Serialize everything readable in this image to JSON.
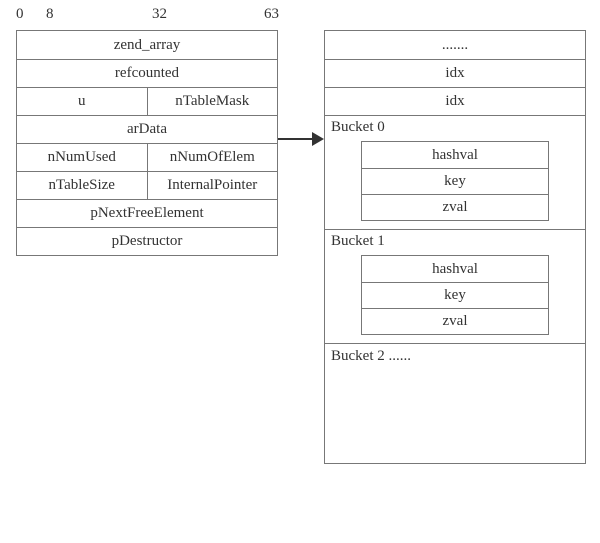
{
  "bit_scale": {
    "v0": "0",
    "v8": "8",
    "v32": "32",
    "v63": "63"
  },
  "struct": {
    "name": "zend_array",
    "refcounted": "refcounted",
    "u": "u",
    "nTableMask": "nTableMask",
    "arData": "arData",
    "nNumUsed": "nNumUsed",
    "nNumOfElem": "nNumOfElem",
    "nTableSize": "nTableSize",
    "InternalPointer": "InternalPointer",
    "pNextFreeElement": "pNextFreeElement",
    "pDestructor": "pDestructor"
  },
  "mem": {
    "preEllipsis": ".......",
    "idx1": "idx",
    "idx2": "idx",
    "bucket0_label": "Bucket 0",
    "bucket1_label": "Bucket 1",
    "bucket2_label": "Bucket 2 ......",
    "hashval": "hashval",
    "key": "key",
    "zval": "zval"
  }
}
